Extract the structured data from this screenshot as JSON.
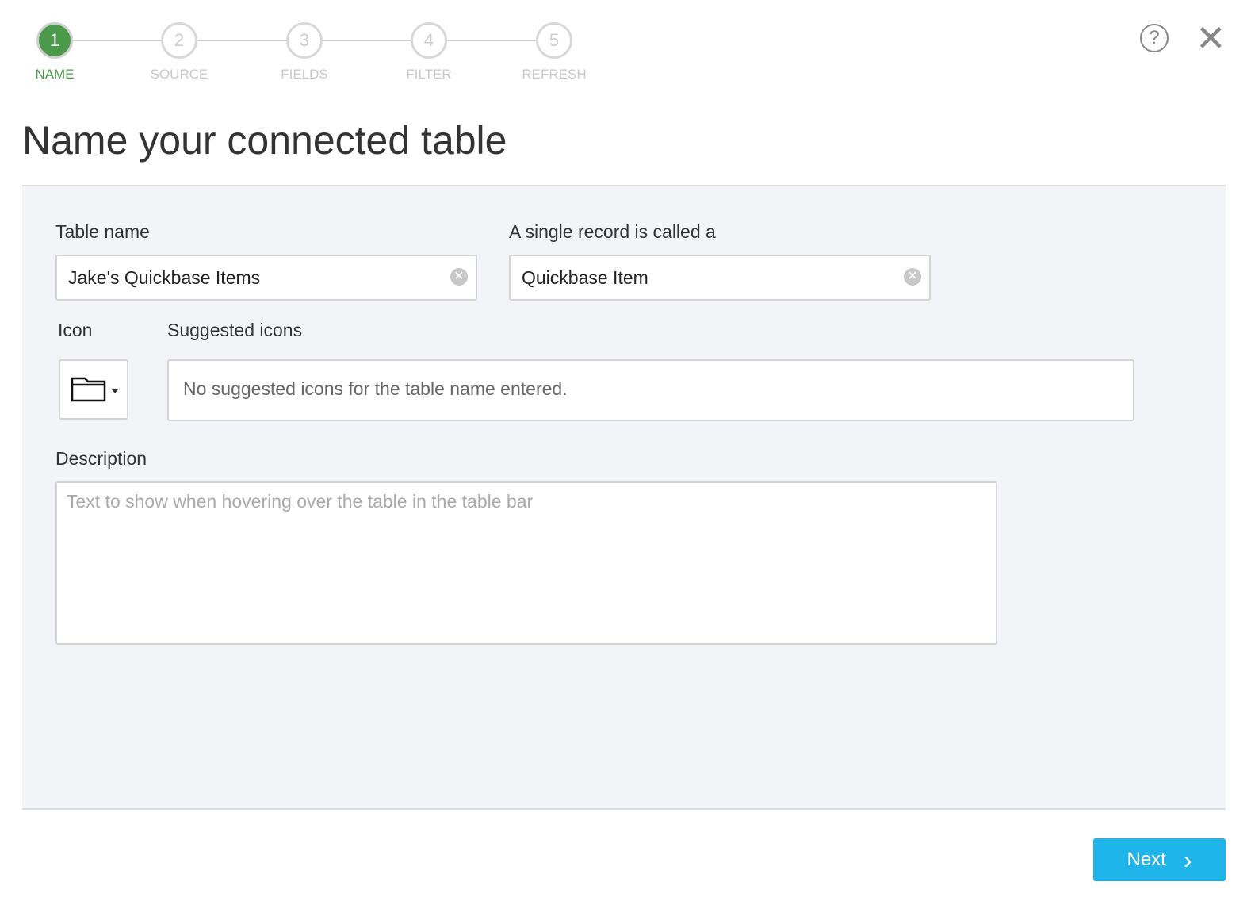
{
  "steps": [
    {
      "num": "1",
      "label": "NAME"
    },
    {
      "num": "2",
      "label": "SOURCE"
    },
    {
      "num": "3",
      "label": "FIELDS"
    },
    {
      "num": "4",
      "label": "FILTER"
    },
    {
      "num": "5",
      "label": "REFRESH"
    }
  ],
  "header": {
    "title": "Name your connected table",
    "help": "?",
    "close": "✕"
  },
  "form": {
    "table_name_label": "Table name",
    "table_name_value": "Jake's Quickbase Items",
    "record_label": "A single record is called a",
    "record_value": "Quickbase Item",
    "icon_label": "Icon",
    "suggested_label": "Suggested icons",
    "suggested_empty": "No suggested icons for the table name entered.",
    "description_label": "Description",
    "description_placeholder": "Text to show when hovering over the table in the table bar"
  },
  "footer": {
    "next_label": "Next",
    "next_icon": "›"
  }
}
